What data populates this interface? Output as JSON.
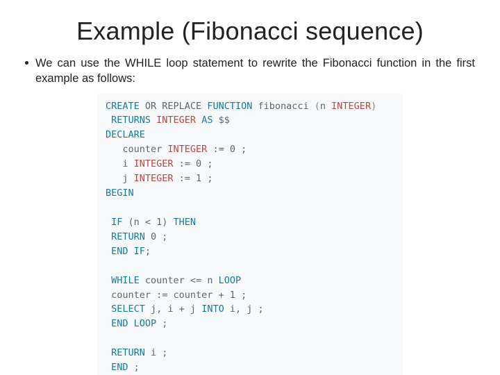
{
  "title": "Example (Fibonacci sequence)",
  "bullet": {
    "prefix": "We can use the",
    "while_kw": "WHILE",
    "suffix": "loop statement to rewrite the Fibonacci function in the first example as follows:"
  },
  "code": {
    "l01_a": "CREATE",
    "l01_b": " OR REPLACE ",
    "l01_c": "FUNCTION",
    "l01_d": " fibonacci ",
    "l01_e": "(",
    "l01_f": "n ",
    "l01_g": "INTEGER",
    "l01_h": ")",
    "l02_a": " RETURNS ",
    "l02_b": "INTEGER",
    "l02_c": " AS",
    "l02_d": " $$",
    "l03_a": "DECLARE",
    "l04_a": "   counter ",
    "l04_b": "INTEGER",
    "l04_c": " := 0 ;",
    "l05_a": "   i ",
    "l05_b": "INTEGER",
    "l05_c": " := 0 ;",
    "l06_a": "   j ",
    "l06_b": "INTEGER",
    "l06_c": " := 1 ;",
    "l07_a": "BEGIN",
    "l08_a": "",
    "l09_a": " IF",
    "l09_b": " (n < 1) ",
    "l09_c": "THEN",
    "l10_a": " RETURN",
    "l10_b": " 0 ;",
    "l11_a": " END",
    "l11_b": " IF",
    "l11_c": ";",
    "l12_a": "",
    "l13_a": " WHILE",
    "l13_b": " counter <= n ",
    "l13_c": "LOOP",
    "l14_a": " counter := counter + 1 ;",
    "l15_a": " SELECT",
    "l15_b": " j, i + j ",
    "l15_c": "INTO",
    "l15_d": " i, j ;",
    "l16_a": " END",
    "l16_b": " LOOP",
    "l16_c": " ;",
    "l17_a": "",
    "l18_a": " RETURN",
    "l18_b": " i ;",
    "l19_a": " END",
    "l19_b": " ;"
  }
}
